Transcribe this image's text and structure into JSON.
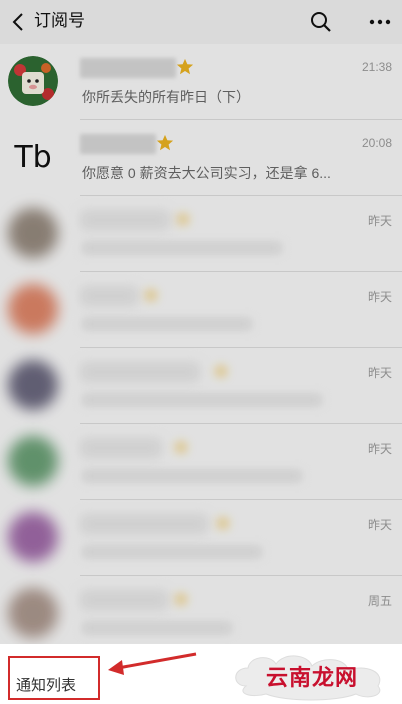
{
  "header": {
    "title": "订阅号",
    "back_icon": "chevron-left-icon",
    "search_icon": "search-icon",
    "more_icon": "more-icon"
  },
  "colors": {
    "star": "#e8b020",
    "annotation_red": "#d22b2b",
    "watermark_red": "#c8102e"
  },
  "subscriptions": [
    {
      "preview": "你所丢失的所有昨日（下）",
      "time": "21:38",
      "starred": true
    },
    {
      "avatar_text": "Tb",
      "preview": "你愿意 0 薪资去大公司实习，还是拿 6...",
      "time": "20:08",
      "starred": true
    },
    {
      "time": "昨天"
    },
    {
      "time": "昨天"
    },
    {
      "time": "昨天"
    },
    {
      "time": "昨天"
    },
    {
      "time": "昨天"
    },
    {
      "time": "周五"
    }
  ],
  "bottom": {
    "notification_label": "通知列表",
    "watermark": "云南龙网"
  }
}
